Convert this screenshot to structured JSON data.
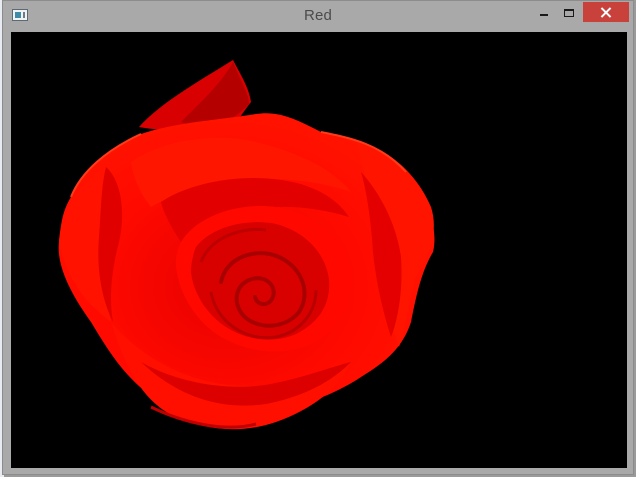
{
  "window": {
    "title": "Red",
    "controls": {
      "minimize_icon": "minimize-icon",
      "maximize_icon": "maximize-icon",
      "close_icon": "close-icon",
      "close_color": "#c8413a"
    }
  },
  "image": {
    "subject_icon": "rose-flower",
    "background_color": "#000000",
    "petal_color": "#ff0000"
  }
}
